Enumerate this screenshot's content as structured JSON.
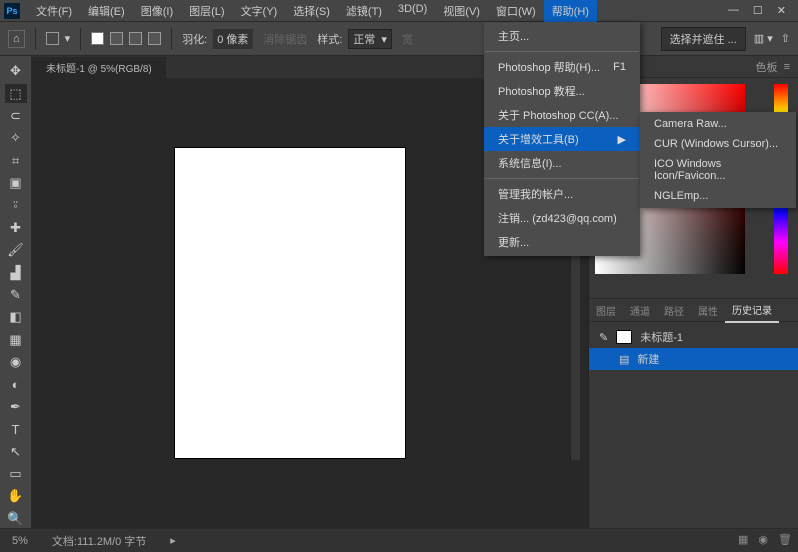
{
  "menubar": [
    "文件(F)",
    "编辑(E)",
    "图像(I)",
    "图层(L)",
    "文字(Y)",
    "选择(S)",
    "滤镜(T)",
    "3D(D)",
    "视图(V)",
    "窗口(W)",
    "帮助(H)"
  ],
  "active_menu_index": 10,
  "optbar": {
    "feather_label": "羽化:",
    "feather_value": "0 像素",
    "antialias": "消除锯齿",
    "style_label": "样式:",
    "style_value": "正常",
    "select_mask": "选择并遮住 ..."
  },
  "doc_tab": "未标题-1 @ 5%(RGB/8)",
  "color_tab": "色板",
  "history_tabs": [
    "图层",
    "通道",
    "路径",
    "属性",
    "历史记录"
  ],
  "history_active": 4,
  "history": {
    "doc": "未标题-1",
    "step": "新建"
  },
  "status": {
    "zoom": "5%",
    "info": "文档:111.2M/0 字节"
  },
  "help_menu": [
    {
      "label": "主页...",
      "sep": true
    },
    {
      "label": "Photoshop 帮助(H)...",
      "accel": "F1"
    },
    {
      "label": "Photoshop 教程..."
    },
    {
      "label": "关于 Photoshop CC(A)..."
    },
    {
      "label": "关于增效工具(B)",
      "sub": true,
      "hl": true
    },
    {
      "label": "系统信息(I)...",
      "sep": true
    },
    {
      "label": "管理我的帐户..."
    },
    {
      "label": "注销... (zd423@qq.com)"
    },
    {
      "label": "更新..."
    }
  ],
  "submenu": [
    "Camera Raw...",
    "CUR (Windows Cursor)...",
    "ICO Windows Icon/Favicon...",
    "NGLEmp..."
  ],
  "tools": [
    "move",
    "marquee",
    "lasso",
    "magic",
    "crop",
    "frame",
    "eyedrop",
    "patch",
    "brush",
    "stamp",
    "history-brush",
    "eraser",
    "gradient",
    "blur",
    "dodge",
    "pen",
    "type",
    "path",
    "rect",
    "hand",
    "zoom"
  ],
  "tool_glyphs": [
    "✥",
    "⬚",
    "⊂",
    "✧",
    "⌗",
    "▣",
    "⍤",
    "✚",
    "🖌",
    "▟",
    "✎",
    "◧",
    "▦",
    "◉",
    "◐",
    "✒",
    "T",
    "↖",
    "▭",
    "✋",
    "🔍"
  ]
}
